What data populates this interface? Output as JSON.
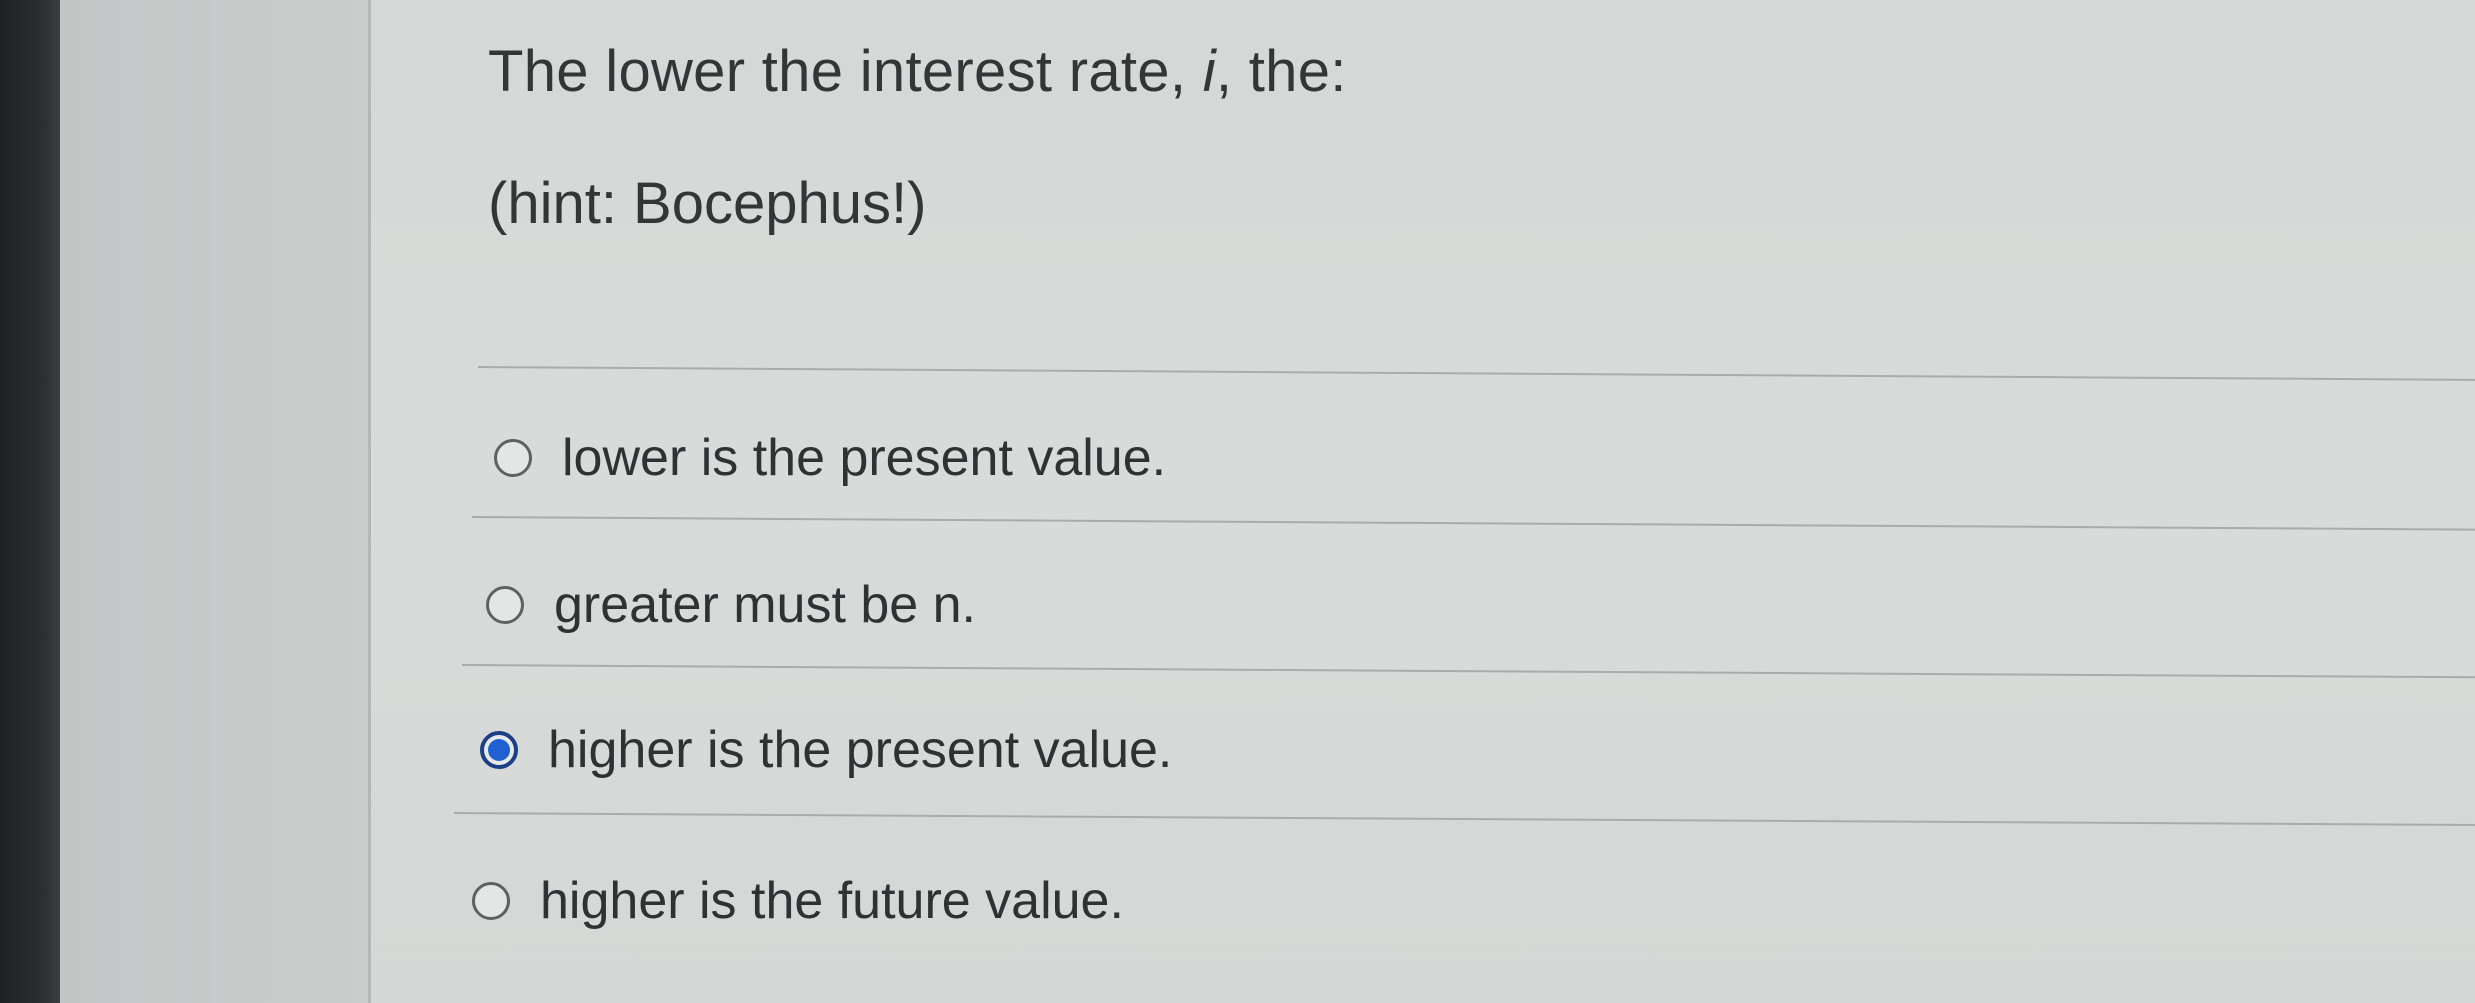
{
  "question": {
    "prefix": "The lower the interest rate, ",
    "variable": "i",
    "suffix": ", the:",
    "hint": "(hint: Bocephus!)"
  },
  "options": [
    {
      "label": "lower is the present value.",
      "selected": false
    },
    {
      "label": "greater must be n.",
      "selected": false
    },
    {
      "label": "higher is the present value.",
      "selected": true
    },
    {
      "label": "higher is the future value.",
      "selected": false
    }
  ],
  "colors": {
    "selected_radio": "#2060d0",
    "text": "#333536"
  }
}
